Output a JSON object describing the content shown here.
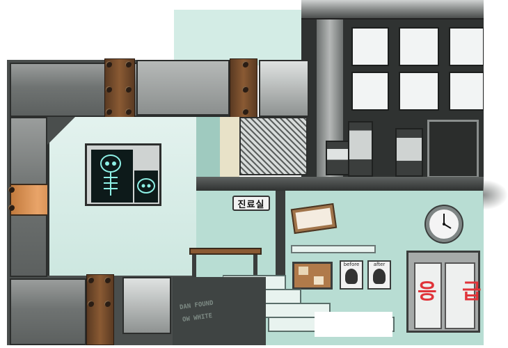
{
  "scene": {
    "clinic_sign": "진료실",
    "emergency_sign_left": "응",
    "emergency_sign_right": "급",
    "photo_before_label": "before",
    "photo_after_label": "after",
    "graffiti_line1": "DAN FOUND",
    "graffiti_line2": "OW WHITE"
  },
  "colors": {
    "wall_mint": "#b8ddd3",
    "metal": "#6f7372",
    "rust": "#8a5a33",
    "accent_orange": "#e9a469",
    "emergency_red": "#e0343a"
  },
  "icons": [
    "xray-poster-icon",
    "clock-icon",
    "certificate-icon",
    "bulletin-board-icon",
    "window-grid-icon",
    "stairs-icon",
    "door-icon"
  ]
}
